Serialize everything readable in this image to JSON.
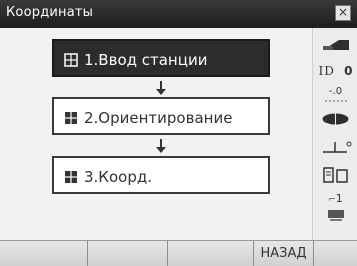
{
  "window": {
    "title": "Координаты",
    "close_symbol": "×"
  },
  "menu": [
    {
      "label": "1.Ввод станции",
      "selected": true
    },
    {
      "label": "2.Ориентирование",
      "selected": false
    },
    {
      "label": "3.Коорд.",
      "selected": false
    }
  ],
  "status_bar": {
    "distance_mode": "ID",
    "distance_value": "0",
    "prism_constant": "-.0",
    "page_number": "1"
  },
  "softkeys": [
    "",
    "",
    "",
    "НАЗАД"
  ],
  "icons": {
    "close": "close-icon",
    "menu_item": "grid-icon",
    "arrow": "arrow-down-icon",
    "battery": "battery-icon",
    "target": "target-icon",
    "tilt": "tilt-compensation-icon",
    "memory": "memory-icon",
    "input_mode": "input-mode-icon"
  }
}
